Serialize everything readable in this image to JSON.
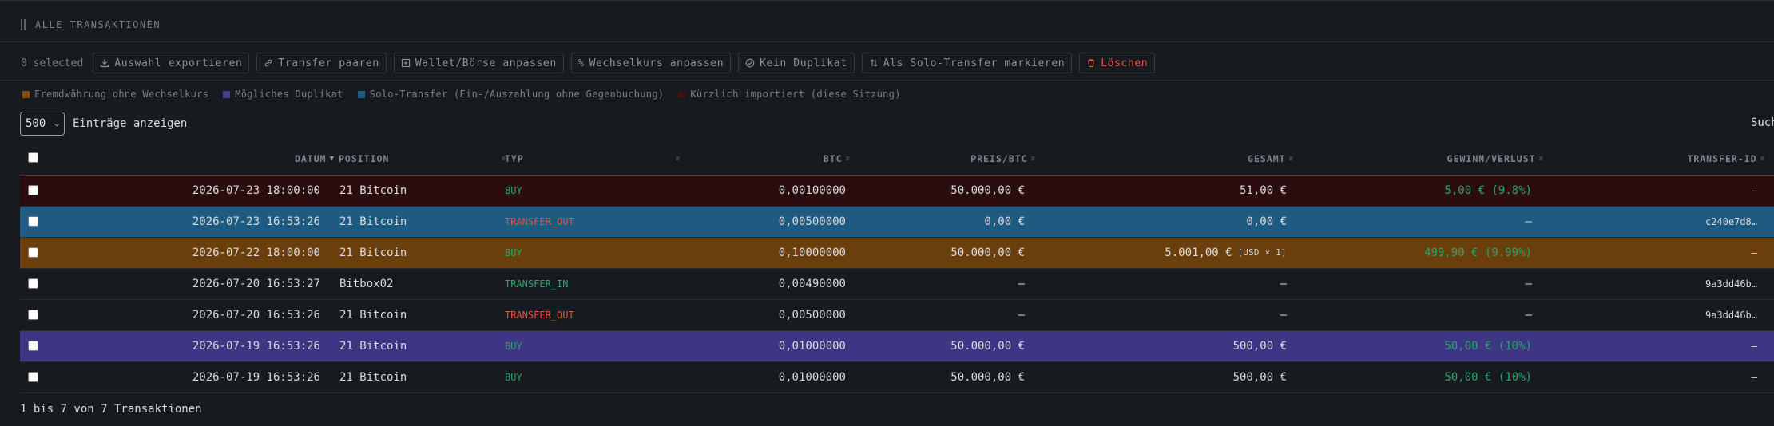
{
  "section": {
    "title": "ALLE TRANSAKTIONEN"
  },
  "toolbar": {
    "selected": "0 selected",
    "buttons": [
      {
        "label": "Auswahl exportieren",
        "icon": "download-icon"
      },
      {
        "label": "Transfer paaren",
        "icon": "link-icon"
      },
      {
        "label": "Wallet/Börse anpassen",
        "icon": "wallet-icon"
      },
      {
        "label": "Wechselkurs anpassen",
        "icon": "percent-icon"
      },
      {
        "label": "Kein Duplikat",
        "icon": "check-circle-icon"
      },
      {
        "label": "Als Solo-Transfer markieren",
        "icon": "arrows-swap-icon"
      },
      {
        "label": "Löschen",
        "icon": "trash-icon"
      }
    ]
  },
  "legend": [
    {
      "label": "Fremdwährung ohne Wechselkurs",
      "color": "#8a4a10"
    },
    {
      "label": "Mögliches Duplikat",
      "color": "#4a3b8f"
    },
    {
      "label": "Solo-Transfer (Ein-/Auszahlung ohne Gegenbuchung)",
      "color": "#1f5a80"
    },
    {
      "label": "Kürzlich importiert (diese Sitzung)",
      "color": "#3a1414"
    }
  ],
  "length_menu": {
    "value": "500",
    "label": "Einträge anzeigen"
  },
  "search": {
    "label": "Suche:"
  },
  "columns": [
    "DATUM",
    "POSITION",
    "TYP",
    "BTC",
    "PREIS/BTC",
    "GESAMT",
    "GEWINN/VERLUST",
    "TRANSFER-ID"
  ],
  "rows": [
    {
      "date": "2026-07-23 18:00:00",
      "position": "21 Bitcoin",
      "type": "BUY",
      "btc": "0,00100000",
      "price": "50.000,00 €",
      "total": "51,00 €",
      "total_tag": "",
      "pnl": "5,00 € (9.8%)",
      "transfer_id": "–",
      "bg": "#2c0d0d"
    },
    {
      "date": "2026-07-23 16:53:26",
      "position": "21 Bitcoin",
      "type": "TRANSFER_OUT",
      "btc": "0,00500000",
      "price": "0,00 €",
      "total": "0,00 €",
      "total_tag": "",
      "pnl": "–",
      "transfer_id": "c240e7d8…",
      "bg": "#1f5a80"
    },
    {
      "date": "2026-07-22 18:00:00",
      "position": "21 Bitcoin",
      "type": "BUY",
      "btc": "0,10000000",
      "price": "50.000,00 €",
      "total": "5.001,00 €",
      "total_tag": "[USD × 1]",
      "pnl": "499,90 € (9.99%)",
      "transfer_id": "–",
      "bg": "#6b3f0c"
    },
    {
      "date": "2026-07-20 16:53:27",
      "position": "Bitbox02",
      "type": "TRANSFER_IN",
      "btc": "0,00490000",
      "price": "–",
      "total": "–",
      "total_tag": "",
      "pnl": "–",
      "transfer_id": "9a3dd46b…",
      "bg": ""
    },
    {
      "date": "2026-07-20 16:53:26",
      "position": "21 Bitcoin",
      "type": "TRANSFER_OUT",
      "btc": "0,00500000",
      "price": "–",
      "total": "–",
      "total_tag": "",
      "pnl": "–",
      "transfer_id": "9a3dd46b…",
      "bg": ""
    },
    {
      "date": "2026-07-19 16:53:26",
      "position": "21 Bitcoin",
      "type": "BUY",
      "btc": "0,01000000",
      "price": "50.000,00 €",
      "total": "500,00 €",
      "total_tag": "",
      "pnl": "50,00 € (10%)",
      "transfer_id": "–",
      "bg": "#3f3585"
    },
    {
      "date": "2026-07-19 16:53:26",
      "position": "21 Bitcoin",
      "type": "BUY",
      "btc": "0,01000000",
      "price": "50.000,00 €",
      "total": "500,00 €",
      "total_tag": "",
      "pnl": "50,00 € (10%)",
      "transfer_id": "–",
      "bg": ""
    }
  ],
  "footer": {
    "info": "1 bis 7 von 7 Transaktionen"
  }
}
